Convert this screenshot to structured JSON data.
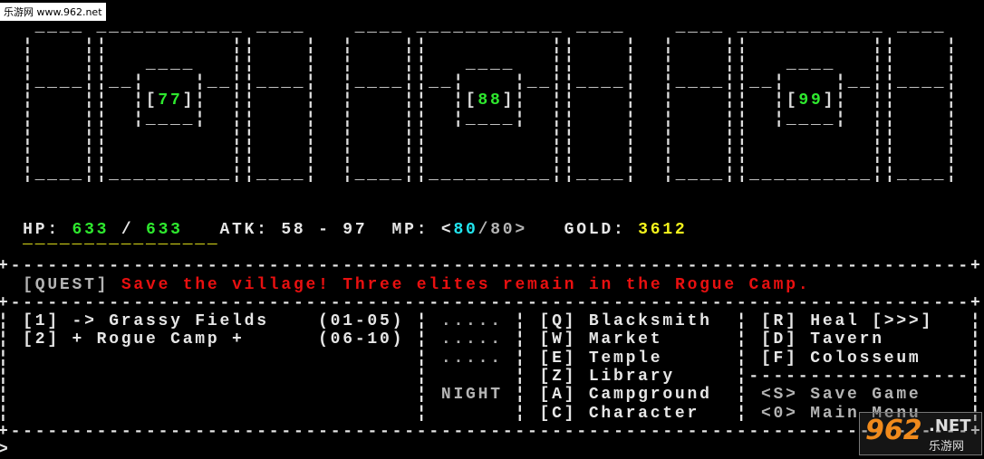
{
  "watermark": {
    "text": "乐游网 www.962.net",
    "logo_number": "962",
    "logo_suffix": ".NET",
    "logo_cn": "乐游网"
  },
  "banner": {
    "numbers": [
      "77",
      "88",
      "99"
    ]
  },
  "stats": {
    "hp_label": "HP: ",
    "hp_current": "633",
    "hp_sep": " / ",
    "hp_max": "633",
    "atk_label": "ATK: 58 - 97",
    "mp_label": "MP: <",
    "mp_current": "80",
    "mp_sep": "/80>",
    "gold_label": "GOLD: ",
    "gold": "3612",
    "bar_underline": "________________"
  },
  "quest": {
    "tag": "[QUEST]",
    "text": "Save the village! Three elites remain in the Rogue Camp."
  },
  "areas": [
    {
      "label": "[1] -> Grassy Fields",
      "levels": "(01-05)"
    },
    {
      "label": "[2] + Rogue Camp +",
      "levels": "(06-10)"
    }
  ],
  "time": {
    "dots": [
      ".....",
      ".....",
      "....."
    ],
    "phase": "NIGHT"
  },
  "town": [
    "[Q] Blacksmith",
    "[W] Market",
    "[E] Temple",
    "[Z] Library",
    "[A] Campground",
    "[C] Character"
  ],
  "services": [
    "[R] Heal [>>>]",
    "[D] Tavern",
    "[F] Colosseum"
  ],
  "system": [
    "<S> Save Game",
    "<0> Main Menu"
  ],
  "prompt": ">",
  "colors": {
    "hp": "#2ee82e",
    "mp": "#22e6f0",
    "gold": "#f4f41c",
    "quest": "#e81010",
    "text": "#e6e6e6",
    "dim": "#b4b4b4"
  }
}
